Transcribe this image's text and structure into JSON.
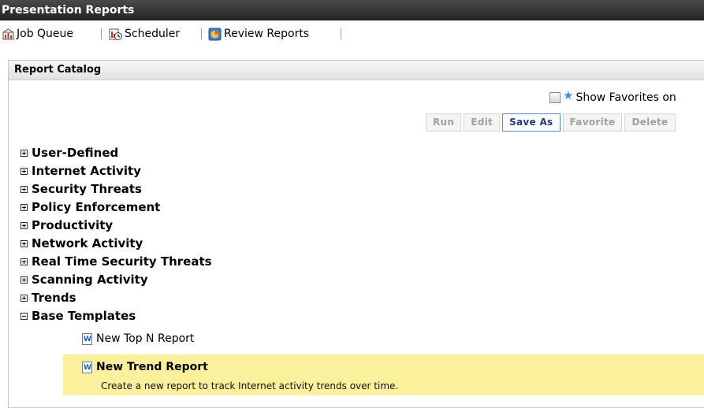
{
  "window": {
    "title": "Presentation Reports"
  },
  "toolbar": {
    "items": [
      {
        "label": "Job Queue",
        "icon": "job-queue-icon"
      },
      {
        "label": "Scheduler",
        "icon": "scheduler-icon"
      },
      {
        "label": "Review Reports",
        "icon": "review-reports-icon"
      }
    ]
  },
  "catalog": {
    "title": "Report Catalog",
    "favorites_label": "Show Favorites on",
    "favorites_checked": false,
    "buttons": {
      "run": "Run",
      "edit": "Edit",
      "save_as": "Save As",
      "favorite": "Favorite",
      "delete": "Delete"
    },
    "tree": [
      {
        "label": "User-Defined",
        "expanded": false
      },
      {
        "label": "Internet Activity",
        "expanded": false
      },
      {
        "label": "Security Threats",
        "expanded": false
      },
      {
        "label": "Policy Enforcement",
        "expanded": false
      },
      {
        "label": "Productivity",
        "expanded": false
      },
      {
        "label": "Network Activity",
        "expanded": false
      },
      {
        "label": "Real Time Security Threats",
        "expanded": false
      },
      {
        "label": "Scanning Activity",
        "expanded": false
      },
      {
        "label": "Trends",
        "expanded": false
      },
      {
        "label": "Base Templates",
        "expanded": true
      }
    ],
    "templates": [
      {
        "label": "New Top N Report"
      },
      {
        "label": "New Trend Report",
        "description": "Create a new report to track Internet activity trends over time.",
        "selected": true
      }
    ],
    "colors": {
      "selected_bg": "#fbf09c",
      "active_button": "#1e3e7a",
      "titlebar": "#2e2e2e"
    }
  }
}
